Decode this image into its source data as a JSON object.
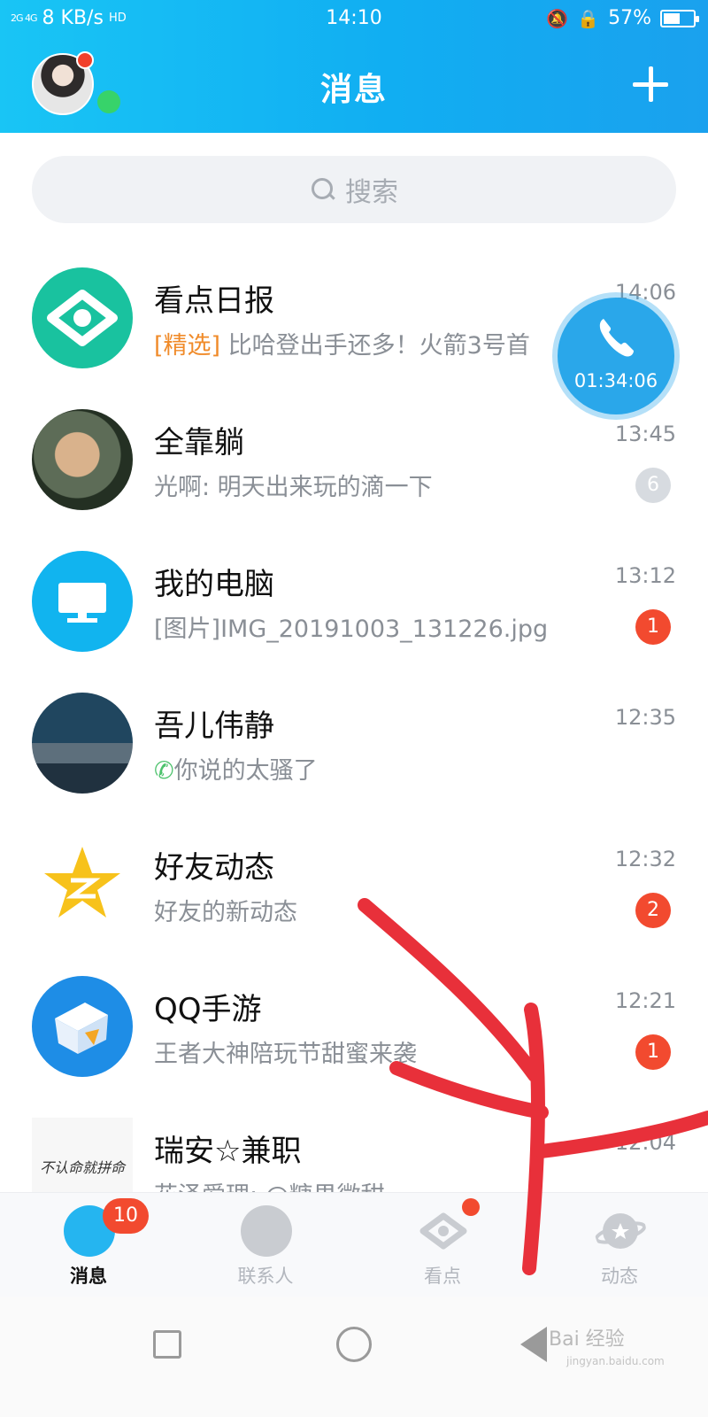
{
  "status_bar": {
    "signal": "2G 4G",
    "speed": "8 KB/s",
    "hd": "HD",
    "time": "14:10",
    "battery": "57%",
    "battery_level": 0.57
  },
  "header": {
    "title": "消息"
  },
  "search": {
    "placeholder": "搜索"
  },
  "chats": [
    {
      "name": "看点日报",
      "tag": "[精选]",
      "preview": " 比哈登出手还多！火箭3号首",
      "time": "14:06",
      "badge": ""
    },
    {
      "name": "全靠躺",
      "tag": "",
      "preview": "光啊: 明天出来玩的滴一下",
      "time": "13:45",
      "badge": "6"
    },
    {
      "name": "我的电脑",
      "tag": "",
      "preview": "[图片]IMG_20191003_131226.jpg",
      "time": "13:12",
      "badge": "1"
    },
    {
      "name": "吾儿伟静",
      "tag": "",
      "preview": "你说的太骚了",
      "time": "12:35",
      "badge": ""
    },
    {
      "name": "好友动态",
      "tag": "",
      "preview": "好友的新动态",
      "time": "12:32",
      "badge": "2"
    },
    {
      "name": "QQ手游",
      "tag": "",
      "preview": "王者大神陪玩节甜蜜来袭",
      "time": "12:21",
      "badge": "1"
    },
    {
      "name": "瑞安☆兼职",
      "tag": "",
      "preview": "花泽爱理: @糖果微甜",
      "time": "12:04",
      "badge": ""
    }
  ],
  "call": {
    "timer": "01:34:06"
  },
  "tabs": [
    {
      "label": "消息",
      "badge": "10",
      "active": true
    },
    {
      "label": "联系人"
    },
    {
      "label": "看点"
    },
    {
      "label": "动态"
    }
  ],
  "watermark": {
    "text": "Bai 经验",
    "sub": "jingyan.baidu.com"
  },
  "avatar_text": {
    "ruian": "不认命就拼命"
  }
}
